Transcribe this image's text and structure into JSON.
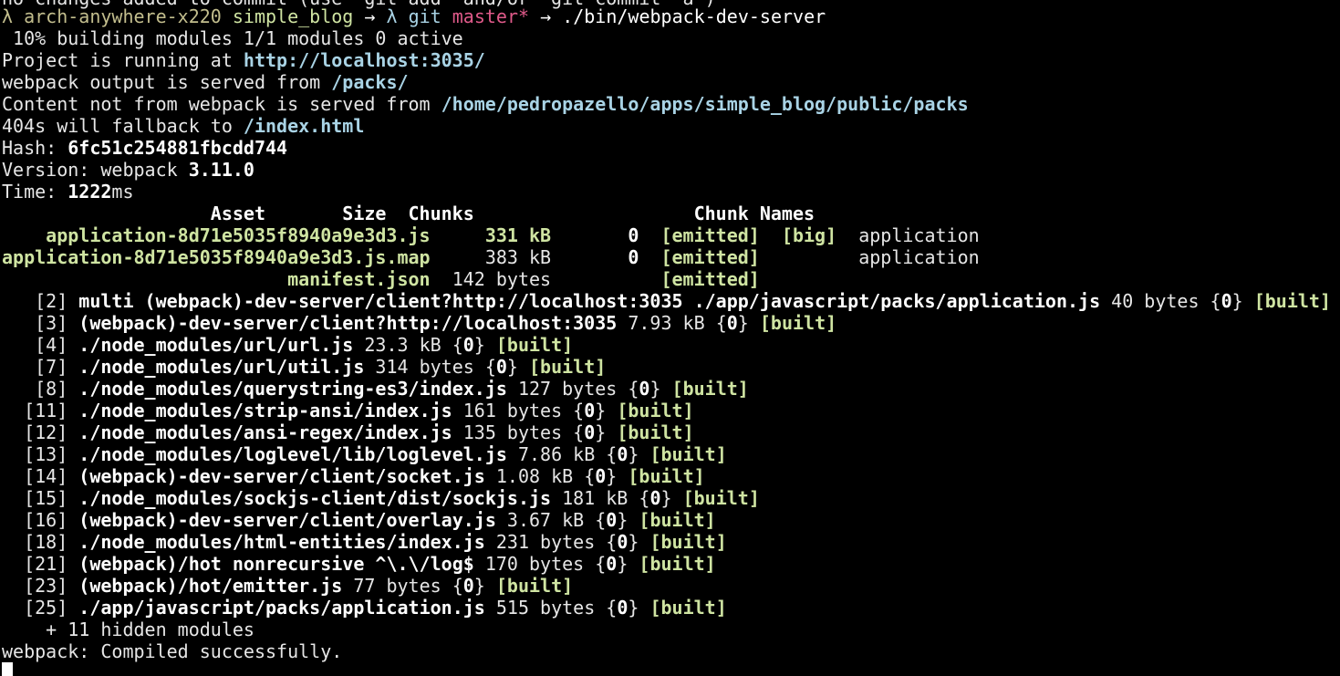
{
  "top_partial": "no changes added to commit (use \"git add\" and/or \"git commit -a\")",
  "prompt": {
    "lambda": "λ",
    "host": "arch-anywhere-x220",
    "dir": "simple_blog",
    "arrow": "→",
    "lambda2": "λ",
    "git": "git",
    "branch": "master*",
    "arrow2": "→",
    "command": "./bin/webpack-dev-server"
  },
  "progress": " 10% building modules 1/1 modules 0 active",
  "info": {
    "running_label": "Project is running at ",
    "running_url": "http://localhost:3035/",
    "output_label": "webpack output is served from ",
    "output_path": "/packs/",
    "content_label": "Content not from webpack is served from ",
    "content_path": "/home/pedropazello/apps/simple_blog/public/packs",
    "fallback_label": "404s will fallback to ",
    "fallback_path": "/index.html",
    "hash_label": "Hash: ",
    "hash": "6fc51c254881fbcdd744",
    "version_label": "Version: webpack ",
    "version": "3.11.0",
    "time_label": "Time: ",
    "time": "1222",
    "time_unit": "ms"
  },
  "asset_table": {
    "headers": {
      "asset": "                   Asset",
      "size": "       Size",
      "chunks": "  Chunks",
      "flags": "                    ",
      "names": "Chunk Names"
    },
    "rows": [
      {
        "asset": "    application-8d71e5035f8940a9e3d3.js",
        "size": "     331 kB",
        "chunks": "       0",
        "emitted": "  [emitted]",
        "big": "  [big]",
        "name": "  application"
      },
      {
        "asset": "application-8d71e5035f8940a9e3d3.js.map",
        "size": "     383 kB",
        "chunks": "       0",
        "emitted": "  [emitted]",
        "big": "       ",
        "name": "  application"
      },
      {
        "asset": "                          manifest.json",
        "size": "  142 bytes",
        "chunks": "        ",
        "emitted": "  [emitted]",
        "big": "",
        "name": ""
      }
    ]
  },
  "modules": [
    {
      "id": "   [2] ",
      "name": "multi (webpack)-dev-server/client?http://localhost:3035 ./app/javascript/packs/application.js",
      "size": " 40 bytes ",
      "chunk_open": "{",
      "chunk": "0",
      "chunk_close": "}",
      "status": " [built]"
    },
    {
      "id": "   [3] ",
      "name": "(webpack)-dev-server/client?http://localhost:3035",
      "size": " 7.93 kB ",
      "chunk_open": "{",
      "chunk": "0",
      "chunk_close": "}",
      "status": " [built]"
    },
    {
      "id": "   [4] ",
      "name": "./node_modules/url/url.js",
      "size": " 23.3 kB ",
      "chunk_open": "{",
      "chunk": "0",
      "chunk_close": "}",
      "status": " [built]"
    },
    {
      "id": "   [7] ",
      "name": "./node_modules/url/util.js",
      "size": " 314 bytes ",
      "chunk_open": "{",
      "chunk": "0",
      "chunk_close": "}",
      "status": " [built]"
    },
    {
      "id": "   [8] ",
      "name": "./node_modules/querystring-es3/index.js",
      "size": " 127 bytes ",
      "chunk_open": "{",
      "chunk": "0",
      "chunk_close": "}",
      "status": " [built]"
    },
    {
      "id": "  [11] ",
      "name": "./node_modules/strip-ansi/index.js",
      "size": " 161 bytes ",
      "chunk_open": "{",
      "chunk": "0",
      "chunk_close": "}",
      "status": " [built]"
    },
    {
      "id": "  [12] ",
      "name": "./node_modules/ansi-regex/index.js",
      "size": " 135 bytes ",
      "chunk_open": "{",
      "chunk": "0",
      "chunk_close": "}",
      "status": " [built]"
    },
    {
      "id": "  [13] ",
      "name": "./node_modules/loglevel/lib/loglevel.js",
      "size": " 7.86 kB ",
      "chunk_open": "{",
      "chunk": "0",
      "chunk_close": "}",
      "status": " [built]"
    },
    {
      "id": "  [14] ",
      "name": "(webpack)-dev-server/client/socket.js",
      "size": " 1.08 kB ",
      "chunk_open": "{",
      "chunk": "0",
      "chunk_close": "}",
      "status": " [built]"
    },
    {
      "id": "  [15] ",
      "name": "./node_modules/sockjs-client/dist/sockjs.js",
      "size": " 181 kB ",
      "chunk_open": "{",
      "chunk": "0",
      "chunk_close": "}",
      "status": " [built]"
    },
    {
      "id": "  [16] ",
      "name": "(webpack)-dev-server/client/overlay.js",
      "size": " 3.67 kB ",
      "chunk_open": "{",
      "chunk": "0",
      "chunk_close": "}",
      "status": " [built]"
    },
    {
      "id": "  [18] ",
      "name": "./node_modules/html-entities/index.js",
      "size": " 231 bytes ",
      "chunk_open": "{",
      "chunk": "0",
      "chunk_close": "}",
      "status": " [built]"
    },
    {
      "id": "  [21] ",
      "name": "(webpack)/hot nonrecursive ^\\.\\/log$",
      "size": " 170 bytes ",
      "chunk_open": "{",
      "chunk": "0",
      "chunk_close": "}",
      "status": " [built]"
    },
    {
      "id": "  [23] ",
      "name": "(webpack)/hot/emitter.js",
      "size": " 77 bytes ",
      "chunk_open": "{",
      "chunk": "0",
      "chunk_close": "}",
      "status": " [built]"
    },
    {
      "id": "  [25] ",
      "name": "./app/javascript/packs/application.js",
      "size": " 515 bytes ",
      "chunk_open": "{",
      "chunk": "0",
      "chunk_close": "}",
      "status": " [built]"
    }
  ],
  "hidden_modules": "    + 11 hidden modules",
  "compiled": "webpack: Compiled successfully.",
  "colors": {
    "background": "#000000",
    "text": "#e6e6e6",
    "green": "#cfe4a2",
    "cyan": "#a9d3e5",
    "branch": "#e05a8a",
    "host": "#c2bd8d"
  }
}
